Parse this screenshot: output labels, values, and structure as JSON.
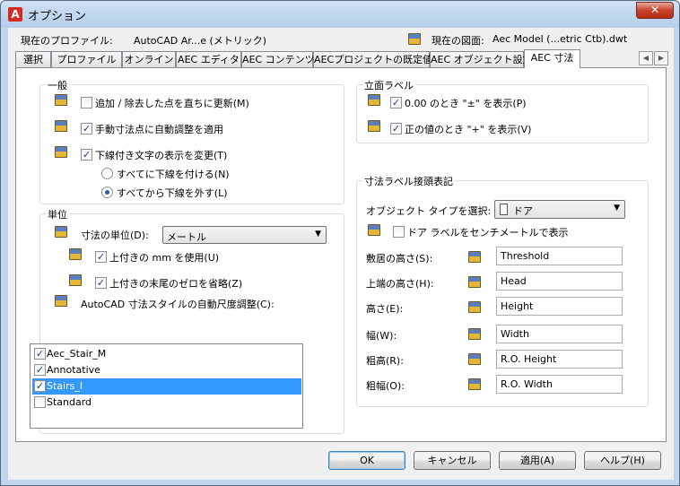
{
  "window": {
    "title": "オプション",
    "close_label": "✕"
  },
  "profile": {
    "current_profile_label": "現在のプロファイル:",
    "current_profile_value": "AutoCAD Ar...e (メトリック)",
    "current_drawing_label": "現在の図面:",
    "current_drawing_value": "Aec Model (...etric Ctb).dwt"
  },
  "tabs": [
    "選択",
    "プロファイル",
    "オンライン",
    "AEC エディタ",
    "AEC コンテンツ",
    "AECプロジェクトの既定値",
    "AEC オブジェクト設定",
    "AEC 寸法"
  ],
  "tab_scroll": {
    "left": "◀",
    "right": "▶"
  },
  "general": {
    "title": "一般",
    "items": [
      {
        "label": "追加 / 除去した点を直ちに更新(M)",
        "checked": false
      },
      {
        "label": "手動寸法点に自動調整を適用",
        "checked": true
      },
      {
        "label": "下線付き文字の表示を変更(T)",
        "checked": true
      }
    ],
    "radios": [
      {
        "label": "すべてに下線を付ける(N)",
        "selected": false
      },
      {
        "label": "すべてから下線を外す(L)",
        "selected": true
      }
    ]
  },
  "units": {
    "title": "単位",
    "dim_unit_label": "寸法の単位(D):",
    "dim_unit_value": "メートル",
    "use_mm_label": "上付きの mm を使用(U)",
    "omit_zeros_label": "上付きの末尾のゼロを省略(Z)",
    "autoscale_label": "AutoCAD 寸法スタイルの自動尺度調整(C):",
    "styles": [
      {
        "label": "Aec_Stair_M",
        "checked": true,
        "selected": false
      },
      {
        "label": "Annotative",
        "checked": true,
        "selected": false
      },
      {
        "label": "Stairs_I",
        "checked": true,
        "selected": true
      },
      {
        "label": "Standard",
        "checked": false,
        "selected": false
      }
    ]
  },
  "elevation": {
    "title": "立面ラベル",
    "show_zero_label": "0.00 のとき \"±\" を表示(P)",
    "show_positive_label": "正の値のとき \"+\" を表示(V)"
  },
  "prefix": {
    "title": "寸法ラベル接頭表記",
    "object_type_label": "オブジェクト タイプを選択:",
    "object_type_value": "ドア",
    "door_cm_label": "ドア ラベルをセンチメートルで表示",
    "fields": [
      {
        "label": "敷居の高さ(S):",
        "value": "Threshold"
      },
      {
        "label": "上端の高さ(H):",
        "value": "Head"
      },
      {
        "label": "高さ(E):",
        "value": "Height"
      },
      {
        "label": "幅(W):",
        "value": "Width"
      },
      {
        "label": "粗高(R):",
        "value": "R.O. Height"
      },
      {
        "label": "粗幅(O):",
        "value": "R.O. Width"
      }
    ]
  },
  "buttons": {
    "ok": "OK",
    "cancel": "キャンセル",
    "apply": "適用(A)",
    "help": "ヘルプ(H)"
  },
  "marks": {
    "check": "✓",
    "dropdown": "▼"
  }
}
